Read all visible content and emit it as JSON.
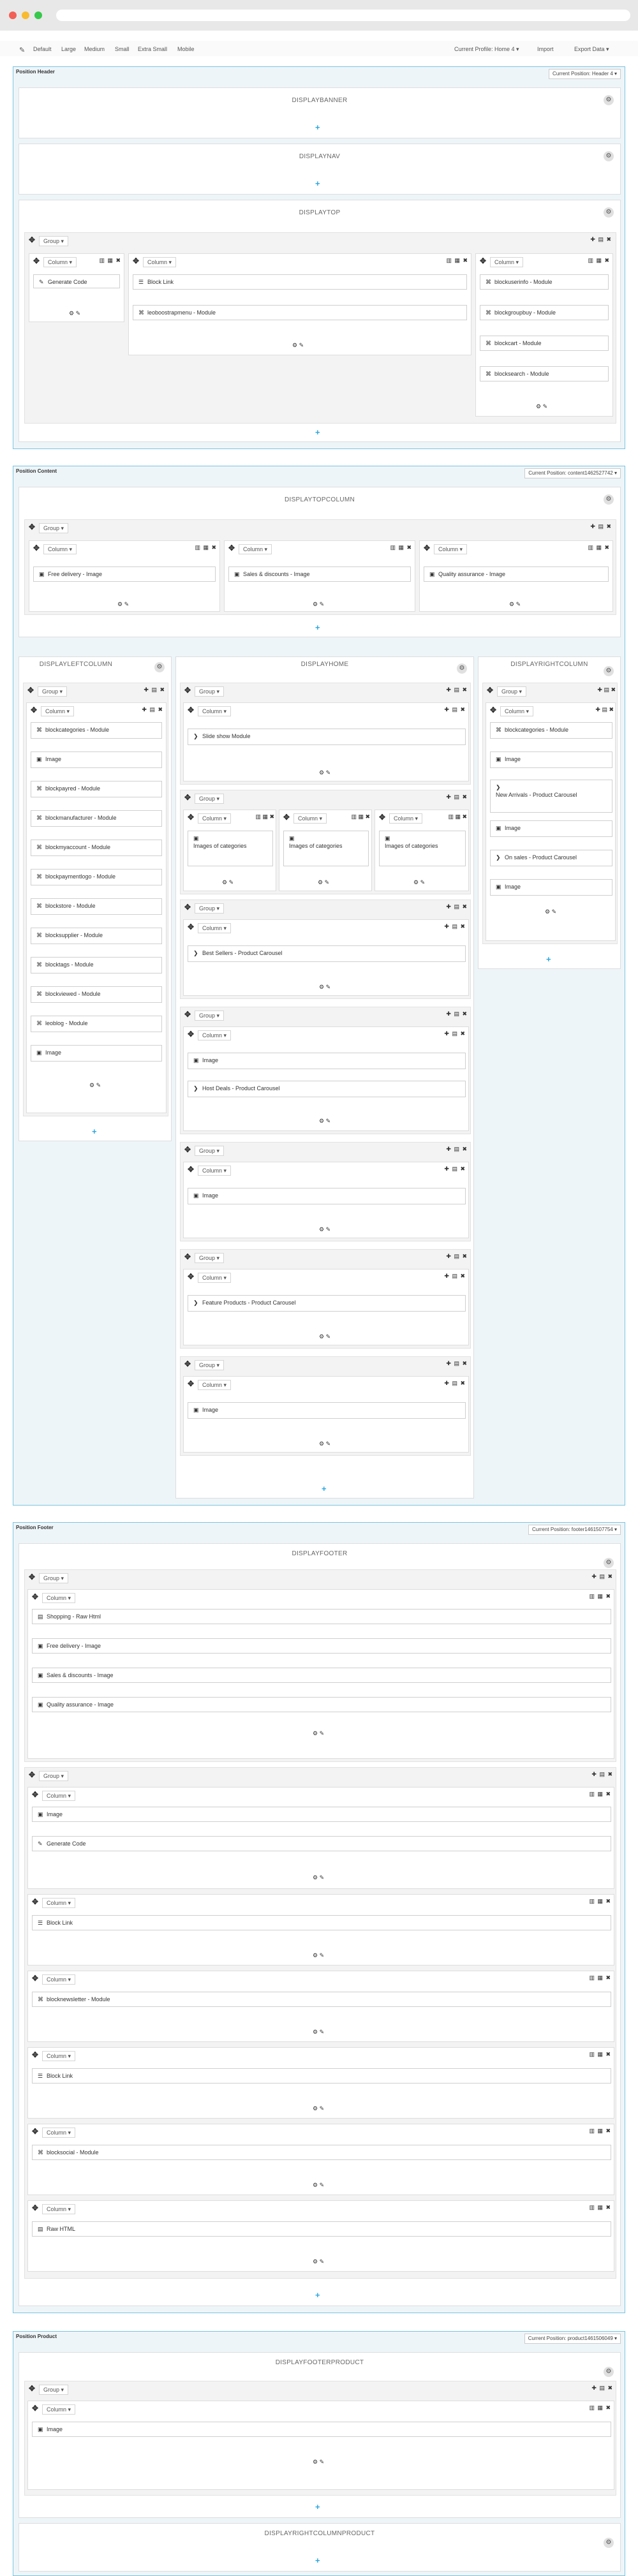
{
  "toolbar": {
    "items": [
      "Default",
      "Large",
      "Medium",
      "Small",
      "Extra Small",
      "Mobile"
    ],
    "profile": "Current Profile: Home 4 ▾",
    "import": "Import",
    "export": "Export Data ▾"
  },
  "labels": {
    "group": "Group ▾",
    "column": "Column ▾",
    "add": "+",
    "move": "✥",
    "col_ctrl": "▥ ▦ ✖",
    "grp_ctrl": "✚ ▤ ✖",
    "foot": "⚙ ✎"
  },
  "header": {
    "title": "Position Header",
    "current": "Current Position: Header 4 ▾",
    "banner": "DISPLAYBANNER",
    "nav": "DISPLAYNAV",
    "top": "DISPLAYTOP",
    "c1": [
      "Generate Code"
    ],
    "c2": [
      "Block Link",
      "leoboostrapmenu - Module"
    ],
    "c3": [
      "blockuserinfo - Module",
      "blockgroupbuy - Module",
      "blockcart - Module",
      "blocksearch - Module"
    ]
  },
  "content": {
    "title": "Position Content",
    "current": "Current Position: content1462527742 ▾",
    "topcol": "DISPLAYTOPCOLUMN",
    "top": [
      "Free delivery - Image",
      "Sales & discounts - Image",
      "Quality assurance - Image"
    ],
    "left": "DISPLAYLEFTCOLUMN",
    "home": "DISPLAYHOME",
    "right": "DISPLAYRIGHTCOLUMN",
    "leftmods": [
      "blockcategories - Module",
      "Image",
      "blockpayred - Module",
      "blockmanufacturer - Module",
      "blockmyaccount - Module",
      "blockpaymentlogo - Module",
      "blockstore - Module",
      "blocksupplier - Module",
      "blocktags - Module",
      "blockviewed - Module",
      "leoblog - Module",
      "Image"
    ],
    "rightmods": [
      "blockcategories - Module",
      "Image",
      "New Arrivals - Product Carousel",
      "Image",
      "On sales - Product Carousel",
      "Image"
    ],
    "slider": "Slide show Module",
    "cats": "Images of categories",
    "best": "Best Sellers - Product Carousel",
    "image": "Image",
    "hot": "Host Deals - Product Carousel",
    "feature": "Feature Products - Product Carousel"
  },
  "footer": {
    "title": "Position Footer",
    "current": "Current Position: footer1461507754 ▾",
    "hook": "DISPLAYFOOTER",
    "g1": [
      "Shopping - Raw Html",
      "Free delivery - Image",
      "Sales & discounts - Image",
      "Quality assurance - Image"
    ],
    "g2a": [
      "Image",
      "Generate Code"
    ],
    "block": "Block Link",
    "newsletter": "blocknewsletter - Module",
    "social": "blocksocial - Module",
    "raw": "Raw HTML"
  },
  "product": {
    "title": "Position Product",
    "current": "Current Position: product1461506049 ▾",
    "footerprod": "DISPLAYFOOTERPRODUCT",
    "rightcol": "DISPLAYRIGHTCOLUMNPRODUCT",
    "image": "Image"
  }
}
